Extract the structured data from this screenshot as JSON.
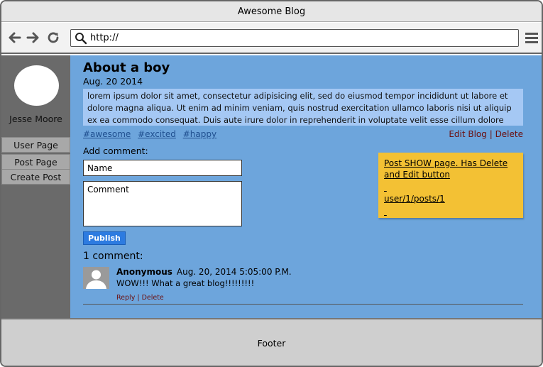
{
  "window": {
    "title": "Awesome Blog"
  },
  "browser": {
    "url": "http://"
  },
  "sidebar": {
    "user_name": "Jesse Moore",
    "items": [
      {
        "label": "User Page"
      },
      {
        "label": "Post Page"
      },
      {
        "label": "Create Post"
      }
    ]
  },
  "post": {
    "title": "About a boy",
    "date": "Aug. 20 2014",
    "body": "lorem ipsum dolor sit amet, consectetur adipisicing elit, sed do eiusmod tempor incididunt ut labore et dolore magna aliqua. Ut enim ad minim veniam, quis nostrud exercitation ullamco laboris nisi ut aliquip ex ea commodo consequat. Duis aute irure dolor in reprehenderit in voluptate velit esse cillum dolore",
    "tags": [
      "#awesome",
      "#excited",
      "#happy"
    ],
    "edit_label": "Edit Blog",
    "separator": " | ",
    "delete_label": "Delete"
  },
  "comment_form": {
    "label": "Add comment:",
    "name_placeholder": "Name",
    "comment_placeholder": "Comment",
    "publish_label": "Publish"
  },
  "note": {
    "line1": "Post SHOW page. Has Delete and Edit button",
    "line2": "user/1/posts/1"
  },
  "comments": {
    "count_label": "1 comment:",
    "items": [
      {
        "author": "Anonymous",
        "timestamp": "Aug. 20, 2014 5:05:00 P.M.",
        "text": "WOW!!! What a great blog!!!!!!!!!",
        "reply_label": "Reply",
        "separator": " | ",
        "delete_label": "Delete"
      }
    ]
  },
  "footer": {
    "label": "Footer"
  },
  "colors": {
    "content_bg": "#6da5dc",
    "post_body_bg": "#a5c8f4",
    "sidebar_bg": "#6a6a6a",
    "note_bg": "#f3c134",
    "publish_bg": "#2d7be0",
    "action_link": "#6b0f0f"
  }
}
